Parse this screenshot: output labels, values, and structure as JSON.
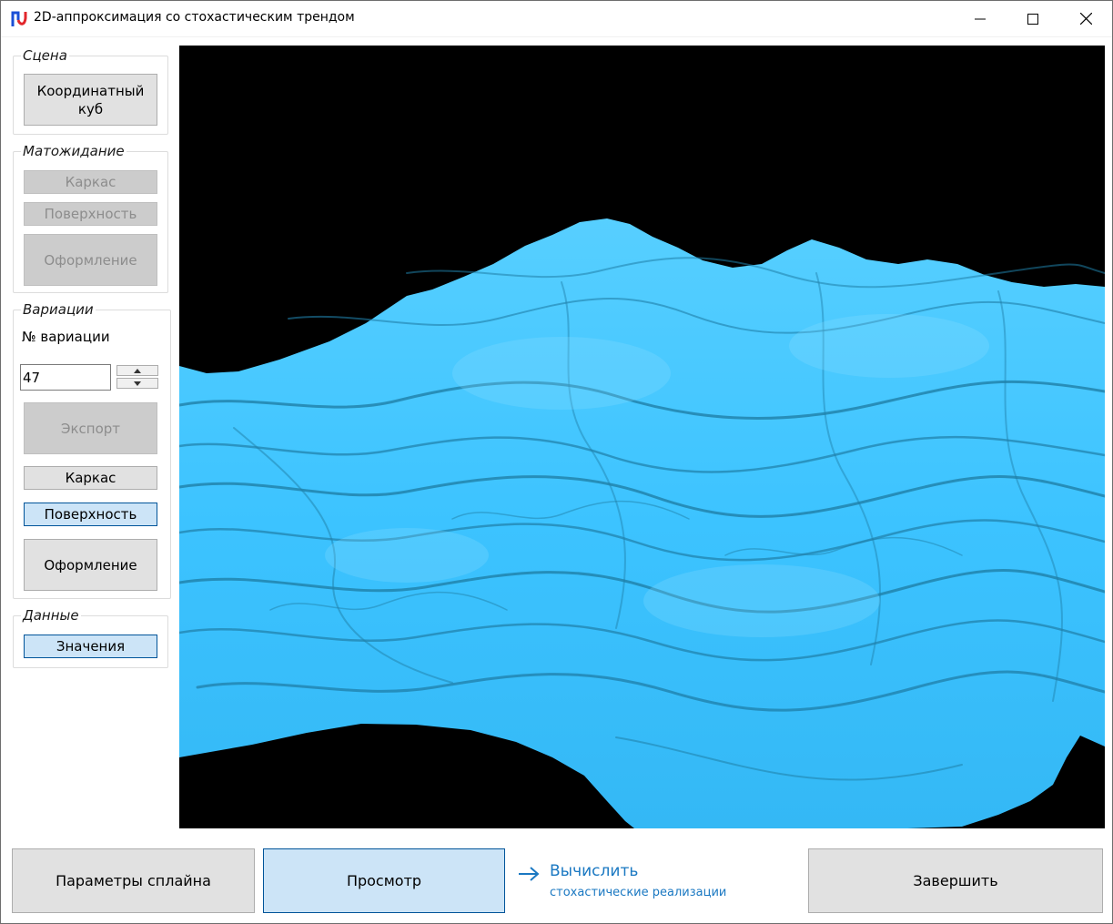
{
  "window": {
    "title": "2D-аппроксимация со стохастическим трендом"
  },
  "sidebar": {
    "scene": {
      "legend": "Сцена",
      "coord_cube_label": "Координатный куб"
    },
    "expectation": {
      "legend": "Матожидание",
      "frame_label": "Каркас",
      "surface_label": "Поверхность",
      "style_label": "Оформление"
    },
    "variations": {
      "legend": "Вариации",
      "number_label": "№ вариации",
      "number_value": "47",
      "export_label": "Экспорт",
      "frame_label": "Каркас",
      "surface_label": "Поверхность",
      "style_label": "Оформление"
    },
    "data": {
      "legend": "Данные",
      "values_label": "Значения"
    }
  },
  "viewport": {
    "background": "#000000",
    "surface_color": "#3cc3ff",
    "shadow_color": "#1f7fa8"
  },
  "footer": {
    "spline_params_label": "Параметры сплайна",
    "preview_label": "Просмотр",
    "calc_title": "Вычислить",
    "calc_subtitle": "стохастические реализации",
    "finish_label": "Завершить",
    "accent_color": "#1a78c2"
  }
}
